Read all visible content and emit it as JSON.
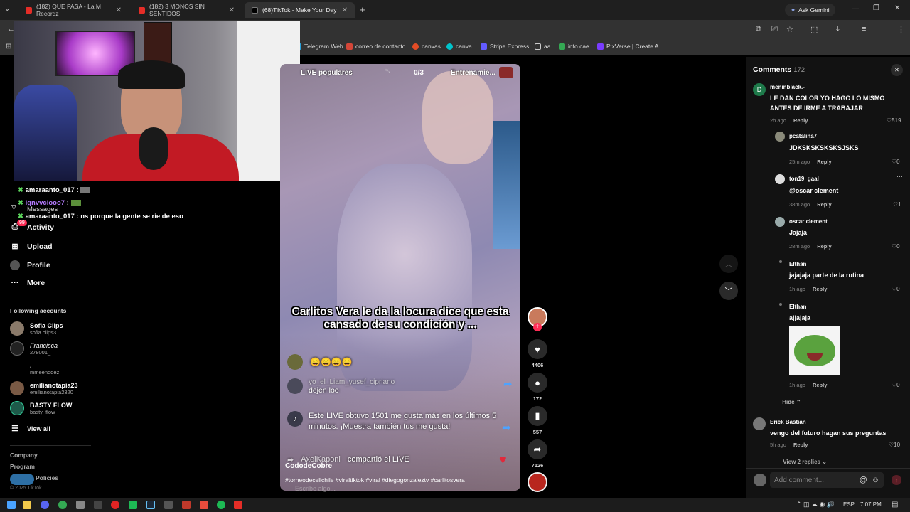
{
  "browser": {
    "tabs": [
      {
        "title": "(182) QUE PASA - La M Recordz",
        "close": "✕"
      },
      {
        "title": "(182) 3 MONOS SIN SENTIDOS",
        "close": "✕"
      },
      {
        "title": "(68)TikTok - Make Your Day",
        "close": "✕"
      }
    ],
    "new_tab": "+",
    "ask_gemini": "Ask Gemini",
    "bookmarks": [
      "Telegram Web",
      "correo de contacto",
      "canvas",
      "canva",
      "Stripe Express",
      "aa",
      "info cae",
      "PixVerse | Create A..."
    ]
  },
  "stream_chat": [
    {
      "user": "amaraanto_017",
      "message": ":"
    },
    {
      "user": "lgnvvciooo7",
      "message": ":"
    },
    {
      "user": "amaraanto_017",
      "message": ": ns porque la gente se rie de eso"
    }
  ],
  "sidebar": {
    "messages": "Messages",
    "activity_badge": "99",
    "nav": [
      {
        "icon": "activity-icon",
        "label": "Activity"
      },
      {
        "icon": "upload-icon",
        "label": "Upload"
      },
      {
        "icon": "profile-icon",
        "label": "Profile"
      },
      {
        "icon": "more-icon",
        "label": "More"
      }
    ],
    "following_title": "Following accounts",
    "accounts": [
      {
        "name": "Sofia Clips",
        "handle": "sofia.clips3"
      },
      {
        "name": "Francisca",
        "handle": "278001_"
      },
      {
        "name": ".",
        "handle": "mmeenddez"
      },
      {
        "name": "emilianotapia23",
        "handle": "emilianotapia2320"
      },
      {
        "name": "BASTY FLOW",
        "handle": "basty_flow"
      }
    ],
    "view_all": "View all",
    "footer": [
      "Company",
      "Program",
      "Policies",
      "© 2025 TikTok"
    ]
  },
  "video": {
    "top_left": "LIVE populares",
    "counter": "0/3",
    "top_right": "Entrenamie...",
    "caption": "Carlitos Vera le da la locura dice que esta cansado de su condición y ...",
    "live_chat": [
      {
        "user": "",
        "text": "😄😄😄😄"
      },
      {
        "user": "yo_el_Liam_yusef_cipriano",
        "text": "dejen loo"
      },
      {
        "user": "",
        "text": "Este LIVE obtuvo 1501 me gusta más en los últimos 5 minutos. ¡Muestra también tus me gusta!"
      },
      {
        "user": "AxelKaponi",
        "text": "compartió el LIVE"
      }
    ],
    "author": "CododeCobre",
    "hashtags": "#torneodecellchile #viraltiktok #viral #diegogonzaleztv #carlitosvera",
    "bottom_hint": "Escribe algo..."
  },
  "actions": [
    {
      "icon": "heart-icon",
      "count": "4406"
    },
    {
      "icon": "comment-icon",
      "count": "172"
    },
    {
      "icon": "bookmark-icon",
      "count": "557"
    },
    {
      "icon": "share-icon",
      "count": "7126"
    }
  ],
  "comments": {
    "title": "Comments",
    "count": "172",
    "items": [
      {
        "user": "meninblack.-",
        "text": "LE DAN COLOR YO HAGO LO MISMO ANTES DE IRME A TRABAJAR",
        "time": "2h ago",
        "reply": "Reply",
        "likes": "519",
        "level": 0
      },
      {
        "user": "pcatalina7",
        "text": "JDKSKSKSKSKSJSKS",
        "time": "25m ago",
        "reply": "Reply",
        "likes": "0",
        "level": 1
      },
      {
        "user": "ton19_gaal",
        "text": "@oscar clement",
        "time": "38m ago",
        "reply": "Reply",
        "likes": "1",
        "level": 1
      },
      {
        "user": "oscar clement",
        "text": "Jajaja",
        "time": "28m ago",
        "reply": "Reply",
        "likes": "0",
        "level": 1
      },
      {
        "user": "Elthan",
        "text": "jajajaja parte de la rutina",
        "time": "1h ago",
        "reply": "Reply",
        "likes": "0",
        "level": 1
      },
      {
        "user": "Elthan",
        "text": "ajjajaja",
        "time": "1h ago",
        "reply": "Reply",
        "likes": "0",
        "level": 1
      },
      {
        "user": "Erick Bastian",
        "text": "vengo del futuro hagan sus preguntas",
        "time": "5h ago",
        "reply": "Reply",
        "likes": "10",
        "level": 0
      }
    ],
    "hide": "Hide",
    "view_replies": "View 2 replies",
    "add_placeholder": "Add comment...",
    "avatar_letter": "D"
  },
  "taskbar": {
    "lang": "ESP",
    "time": "7:07 PM"
  },
  "colors": {
    "accent": "#fe2c55",
    "panel": "#121212",
    "chrome": "#323232"
  }
}
